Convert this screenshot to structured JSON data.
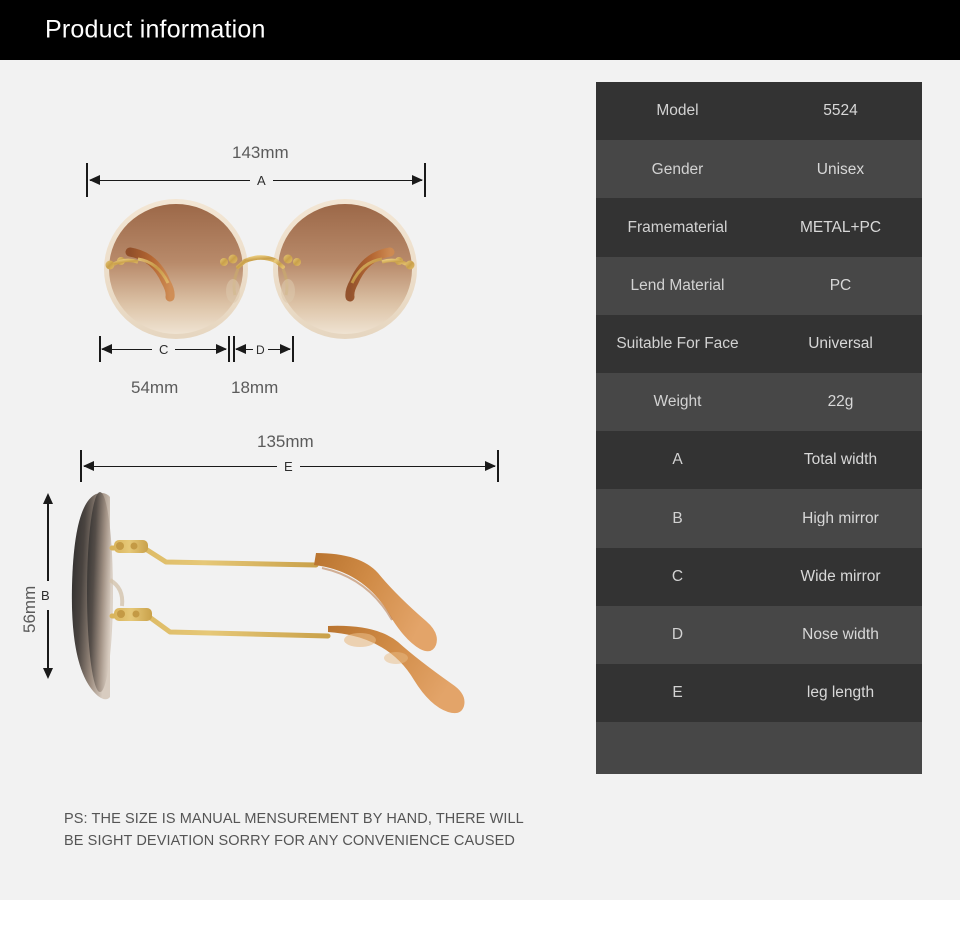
{
  "header": {
    "title": "Product information"
  },
  "spec_table": {
    "rows": [
      {
        "label": "Model",
        "value": "5524"
      },
      {
        "label": "Gender",
        "value": "Unisex"
      },
      {
        "label": "Framematerial",
        "value": "METAL+PC"
      },
      {
        "label": "Lend Material",
        "value": "PC"
      },
      {
        "label": "Suitable For Face",
        "value": "Universal"
      },
      {
        "label": "Weight",
        "value": "22g"
      },
      {
        "label": "A",
        "value": "Total width"
      },
      {
        "label": "B",
        "value": "High mirror"
      },
      {
        "label": "C",
        "value": "Wide mirror"
      },
      {
        "label": "D",
        "value": "Nose width"
      },
      {
        "label": "E",
        "value": "leg length"
      }
    ]
  },
  "dimensions": {
    "total_width": {
      "letter": "A",
      "value": "143mm"
    },
    "wide_mirror": {
      "letter": "C",
      "value": "54mm"
    },
    "nose_width": {
      "letter": "D",
      "value": "18mm"
    },
    "leg_length": {
      "letter": "E",
      "value": "135mm"
    },
    "high_mirror": {
      "letter": "B",
      "value": "56mm"
    }
  },
  "note": {
    "line1": "PS:  THE SIZE IS MANUAL MENSUREMENT BY HAND, THERE WILL",
    "line2": "BE SIGHT DEVIATION SORRY FOR ANY CONVENIENCE CAUSED"
  },
  "colors": {
    "header_bg": "#000000",
    "panel_bg": "#f2f2f2",
    "row_dark": "#333333",
    "row_light": "#474747",
    "text_light": "#d6d6d6",
    "lens_brown": "#9a6a4a",
    "metal_gold": "#d9b45c",
    "tortoise": "#b5632c"
  }
}
